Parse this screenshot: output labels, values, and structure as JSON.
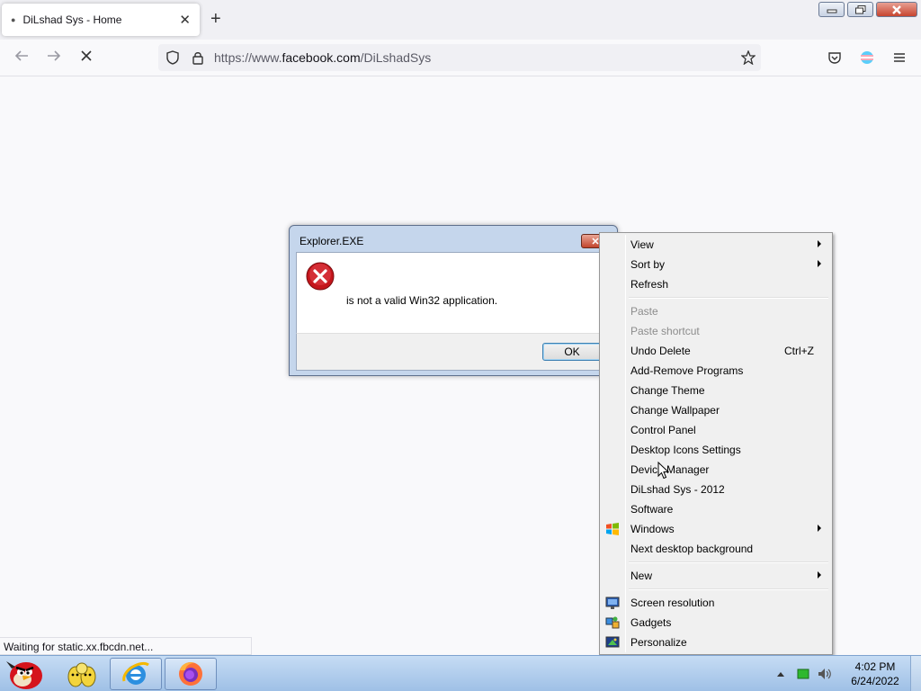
{
  "browser": {
    "tab": {
      "title": "DiLshad Sys - Home",
      "close": "✕"
    },
    "new_tab": "+",
    "url": {
      "prefix": "https://www.",
      "host": "facebook.com",
      "path": "/DiLshadSys"
    },
    "status": "Waiting for static.xx.fbcdn.net..."
  },
  "dialog": {
    "title": "Explorer.EXE",
    "message": "is not a valid Win32 application.",
    "ok_label": "OK",
    "close": "✕"
  },
  "context_menu": {
    "items": [
      {
        "label": "View",
        "submenu": true
      },
      {
        "label": "Sort by",
        "submenu": true
      },
      {
        "label": "Refresh"
      },
      {
        "label": "Paste",
        "disabled": true
      },
      {
        "label": "Paste shortcut",
        "disabled": true
      },
      {
        "label": "Undo Delete",
        "shortcut": "Ctrl+Z"
      },
      {
        "label": "Add-Remove Programs"
      },
      {
        "label": "Change Theme"
      },
      {
        "label": "Change Wallpaper"
      },
      {
        "label": "Control Panel"
      },
      {
        "label": "Desktop Icons Settings"
      },
      {
        "label": "Device Manager"
      },
      {
        "label": "DiLshad Sys - 2012"
      },
      {
        "label": "Software"
      },
      {
        "label": "Windows",
        "submenu": true,
        "icon": "windows-logo-icon"
      },
      {
        "label": "Next desktop background"
      },
      {
        "label": "New",
        "submenu": true
      },
      {
        "label": "Screen resolution",
        "icon": "monitor-icon"
      },
      {
        "label": "Gadgets",
        "icon": "gadgets-icon"
      },
      {
        "label": "Personalize",
        "icon": "personalize-icon"
      }
    ]
  },
  "taskbar": {
    "clock_time": "4:02 PM",
    "clock_date": "6/24/2022",
    "apps": [
      "angry-birds-icon",
      "folder-icon",
      "internet-explorer-icon",
      "firefox-icon"
    ]
  },
  "colors": {
    "error_red": "#d9202a",
    "taskbar_top": "#c6dcf4",
    "firefox_orange": "#ff7139"
  }
}
